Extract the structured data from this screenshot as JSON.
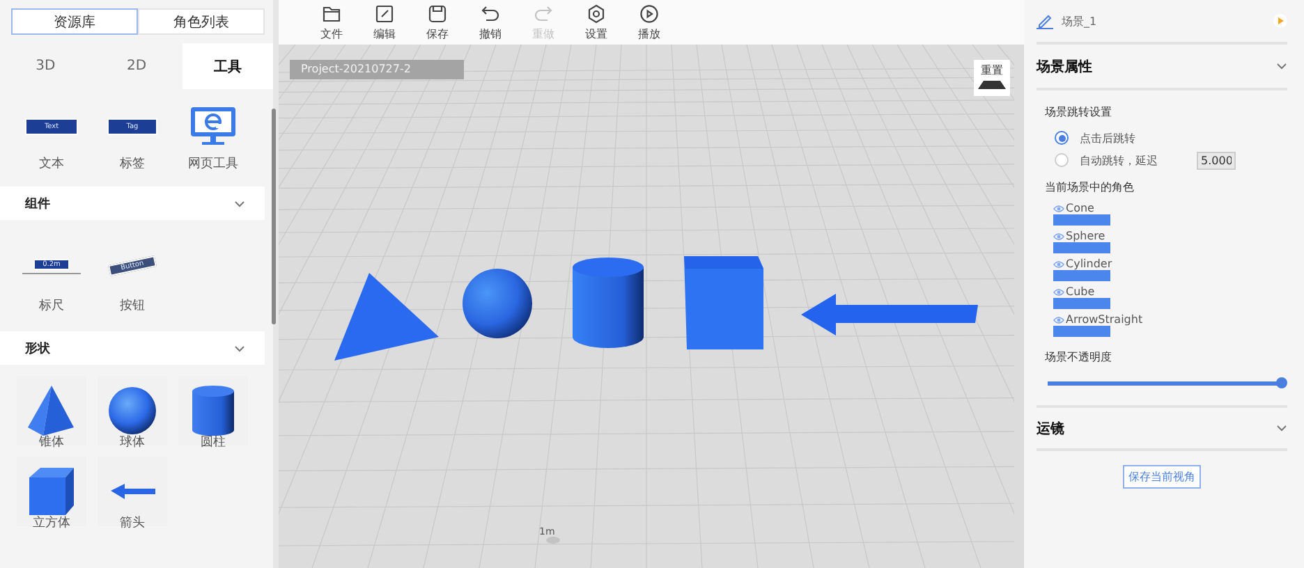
{
  "left_panel": {
    "tabs": [
      {
        "label": "资源库",
        "selected": true
      },
      {
        "label": "角色列表",
        "selected": false
      }
    ],
    "sub_tabs": [
      {
        "label": "3D",
        "selected": false
      },
      {
        "label": "2D",
        "selected": false
      },
      {
        "label": "工具",
        "selected": true
      }
    ],
    "tools": [
      {
        "kind": "text",
        "label": "文本",
        "preview_text": "Text"
      },
      {
        "kind": "tag",
        "label": "标签",
        "preview_text": "Tag"
      },
      {
        "kind": "web",
        "label": "网页工具"
      }
    ],
    "sections": [
      {
        "title": "组件",
        "items": [
          {
            "kind": "ruler",
            "label": "标尺",
            "preview_text": "0.2m"
          },
          {
            "kind": "button",
            "label": "按钮",
            "preview_text": "Button"
          }
        ]
      },
      {
        "title": "形状",
        "items": [
          {
            "kind": "cone",
            "label": "锥体"
          },
          {
            "kind": "sphere",
            "label": "球体"
          },
          {
            "kind": "cylinder",
            "label": "圆柱"
          },
          {
            "kind": "cube",
            "label": "立方体"
          },
          {
            "kind": "arrow",
            "label": "箭头"
          }
        ]
      }
    ]
  },
  "toolbar": [
    {
      "kind": "folder",
      "label": "文件",
      "disabled": false
    },
    {
      "kind": "edit",
      "label": "编辑",
      "disabled": false
    },
    {
      "kind": "save",
      "label": "保存",
      "disabled": false
    },
    {
      "kind": "undo",
      "label": "撤销",
      "disabled": false
    },
    {
      "kind": "redo",
      "label": "重做",
      "disabled": true
    },
    {
      "kind": "settings",
      "label": "设置",
      "disabled": false
    },
    {
      "kind": "play",
      "label": "播放",
      "disabled": false
    }
  ],
  "viewport": {
    "project": "Project-20210727-2",
    "reset": "重置",
    "scale_label": "1m",
    "objects": [
      {
        "kind": "cone"
      },
      {
        "kind": "sphere"
      },
      {
        "kind": "cylinder"
      },
      {
        "kind": "cube"
      },
      {
        "kind": "arrow"
      }
    ]
  },
  "right_panel": {
    "scene_name": "场景_1",
    "properties": {
      "title": "场景属性",
      "jump_title": "场景跳转设置",
      "jump_options": [
        {
          "label": "点击后跳转",
          "selected": true
        },
        {
          "label": "自动跳转，延迟",
          "selected": false,
          "value": "5.000"
        }
      ],
      "roles_title": "当前场景中的角色",
      "roles": [
        {
          "name": "Cone",
          "visible": true
        },
        {
          "name": "Sphere",
          "visible": true
        },
        {
          "name": "Cylinder",
          "visible": true
        },
        {
          "name": "Cube",
          "visible": true
        },
        {
          "name": "ArrowStraight",
          "visible": true
        }
      ],
      "opacity_title": "场景不透明度",
      "opacity": {
        "level": 1
      }
    },
    "camera": {
      "title": "运镜"
    },
    "save_button": "保存当前视角"
  }
}
